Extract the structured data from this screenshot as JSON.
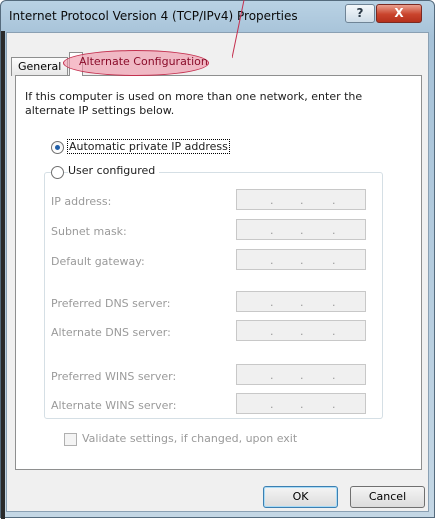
{
  "window": {
    "title": "Internet Protocol Version 4 (TCP/IPv4) Properties",
    "help_label": "?",
    "close_label": "X"
  },
  "tabs": [
    {
      "label": "General"
    },
    {
      "label": "Alternate Configuration"
    }
  ],
  "intro_text": "If this computer is used on more than one network, enter the alternate IP settings below.",
  "options": {
    "automatic_label": "Automatic private IP address",
    "user_label": "User configured",
    "selected": "automatic"
  },
  "fields": [
    {
      "label": "IP address:"
    },
    {
      "label": "Subnet mask:"
    },
    {
      "label": "Default gateway:"
    },
    {
      "label": "Preferred DNS server:"
    },
    {
      "label": "Alternate DNS server:"
    },
    {
      "label": "Preferred WINS server:"
    },
    {
      "label": "Alternate WINS server:"
    }
  ],
  "ip_dots": ".",
  "validate_label": "Validate settings, if changed, upon exit",
  "validate_checked": false,
  "buttons": {
    "ok": "OK",
    "cancel": "Cancel"
  },
  "colors": {
    "highlight": "#f096aa",
    "accent": "#1f5ea8"
  }
}
